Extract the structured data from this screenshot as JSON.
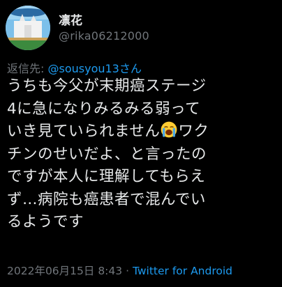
{
  "user": {
    "display_name": "凛花",
    "handle": "@rika06212000"
  },
  "reply_to": {
    "prefix": "返信先:",
    "mention": "@sousyou13さん"
  },
  "tweet": {
    "text_part1": "うちも今父が末期癌ステージ\n4に急になりみるみる弱って\nいき見ていられません",
    "emoji": "loudly-crying-face",
    "text_part2": "ワク\nチンのせいだよ、と言ったの\nですが本人に理解してもらえ\nず…病院も癌患者で混んでい\nるようです"
  },
  "meta": {
    "timestamp": "2022年06月15日 8:43",
    "separator": "·",
    "source": "Twitter for Android"
  },
  "colors": {
    "background": "#000000",
    "text": "#e7e9ea",
    "secondary": "#71767b",
    "link": "#1d9bf0"
  }
}
